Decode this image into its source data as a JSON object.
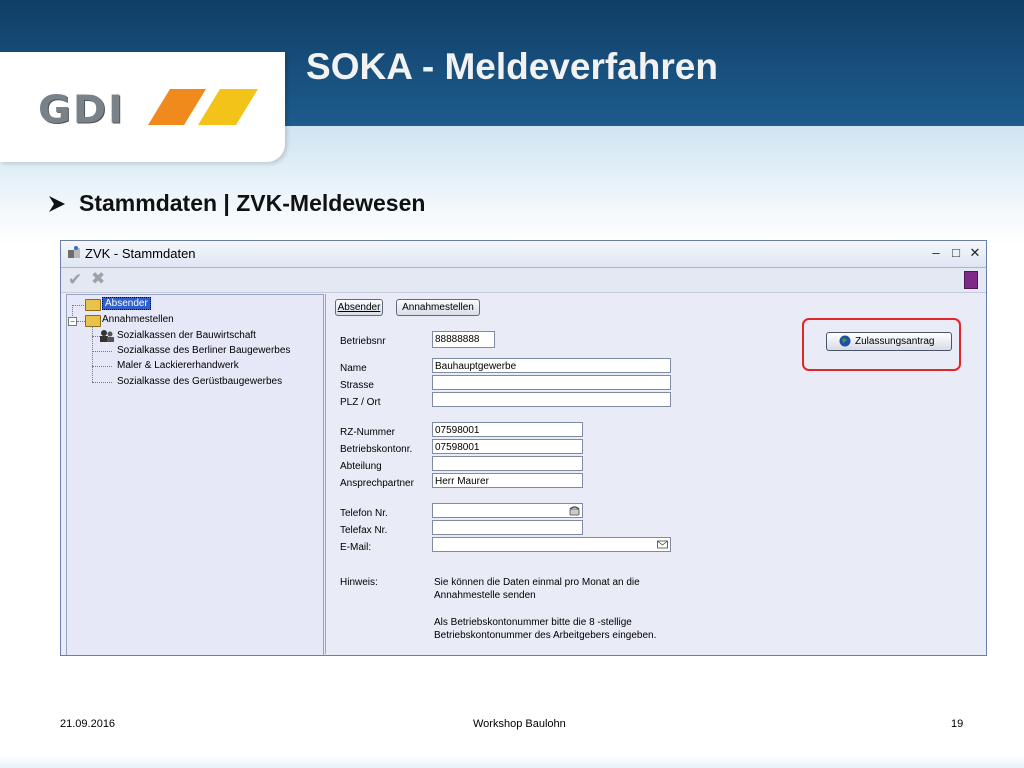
{
  "slide": {
    "title": "SOKA - Meldeverfahren",
    "logo_text": "GDI",
    "bullet": "Stammdaten | ZVK-Meldewesen",
    "footer": {
      "date": "21.09.2016",
      "center": "Workshop Baulohn",
      "page": "19"
    }
  },
  "colors": {
    "header": "#184f7d",
    "accent_orange": "#f08a1c",
    "accent_yellow": "#f3c31a",
    "highlight_red": "#e0252b",
    "tree_selected": "#2f5fc8"
  },
  "window": {
    "title": "ZVK - Stammdaten",
    "controls": {
      "minimize": "–",
      "maximize": "□",
      "close": "✕"
    },
    "toolbar": {
      "confirm_icon": "checkmark-icon",
      "cancel_icon": "x-icon",
      "book_icon": "book-icon"
    }
  },
  "tree": {
    "absender": "Absender",
    "annahmestellen": "Annahmestellen",
    "children": [
      "Sozialkassen der Bauwirtschaft",
      "Sozialkasse des Berliner Baugewerbes",
      "Maler & Lackiererhandwerk",
      "Sozialkasse des Gerüstbaugewerbes"
    ]
  },
  "tabs": {
    "absender": "Absender",
    "annahmestellen": "Annahmestellen"
  },
  "zulassung_button": "Zulassungsantrag",
  "form": {
    "betriebsnr": {
      "label": "Betriebsnr",
      "value": "88888888"
    },
    "name": {
      "label": "Name",
      "value": "Bauhauptgewerbe"
    },
    "strasse": {
      "label": "Strasse",
      "value": ""
    },
    "plz": {
      "label": "PLZ / Ort",
      "value": ""
    },
    "rz": {
      "label": "RZ-Nummer",
      "value": "07598001"
    },
    "konto": {
      "label": "Betriebskontonr.",
      "value": "07598001"
    },
    "abteilung": {
      "label": "Abteilung",
      "value": ""
    },
    "ansprech": {
      "label": "Ansprechpartner",
      "value": "Herr Maurer"
    },
    "telefon": {
      "label": "Telefon Nr.",
      "value": ""
    },
    "telefax": {
      "label": "Telefax Nr.",
      "value": ""
    },
    "email": {
      "label": "E-Mail:",
      "value": ""
    },
    "hinweis": {
      "label": "Hinweis:",
      "line1": "Sie können die Daten einmal pro Monat an die",
      "line2": "Annahmestelle senden",
      "line3": "Als Betriebskontonummer bitte die 8 -stellige",
      "line4": "Betriebskontonummer des Arbeitgebers eingeben."
    }
  }
}
